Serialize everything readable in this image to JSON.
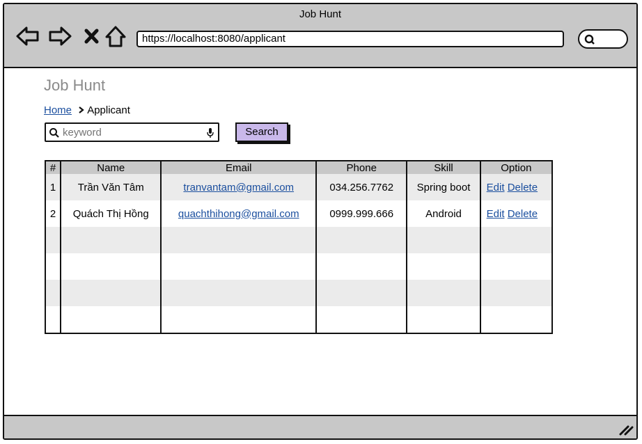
{
  "window": {
    "title": "Job Hunt",
    "url": "https://localhost:8080/applicant",
    "icons": [
      "back-icon",
      "forward-icon",
      "close-icon",
      "home-icon",
      "search-icon"
    ]
  },
  "page": {
    "app_title": "Job Hunt",
    "breadcrumb": {
      "home": "Home",
      "current": "Applicant"
    },
    "search": {
      "placeholder": "keyword",
      "value": "",
      "button": "Search"
    }
  },
  "table": {
    "headers": [
      "#",
      "Name",
      "Email",
      "Phone",
      "Skill",
      "Option"
    ],
    "rows": [
      {
        "no": "1",
        "name": "Trần Văn Tâm",
        "email": "tranvantam@gmail.com",
        "phone": "034.256.7762",
        "skill": "Spring boot",
        "edit": "Edit",
        "delete": "Delete"
      },
      {
        "no": "2",
        "name": "Quách Thị Hồng",
        "email": "quachthihong@gmail.com",
        "phone": "0999.999.666",
        "skill": "Android",
        "edit": "Edit",
        "delete": "Delete"
      }
    ]
  },
  "colors": {
    "chrome": "#c8c8c8",
    "button": "#c9b8ea",
    "link": "#1a4e9e",
    "stripe": "#ebebeb"
  }
}
